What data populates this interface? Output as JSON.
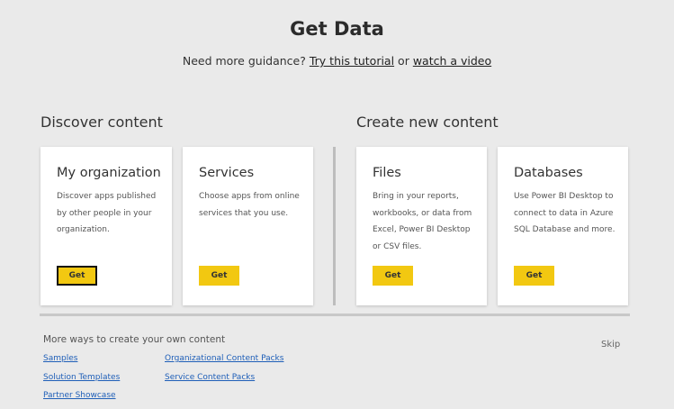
{
  "header": {
    "title": "Get Data",
    "guidance_prefix": "Need more guidance? ",
    "tutorial_link": "Try this tutorial",
    "or_text": " or ",
    "video_link": "watch a video"
  },
  "sections": {
    "discover_heading": "Discover content",
    "create_heading": "Create new content"
  },
  "cards": [
    {
      "title": "My organization",
      "description": "Discover apps published by other people in your organization.",
      "button": "Get"
    },
    {
      "title": "Services",
      "description": "Choose apps from online services that you use.",
      "button": "Get"
    },
    {
      "title": "Files",
      "description": "Bring in your reports, workbooks, or data from Excel, Power BI Desktop or CSV files.",
      "button": "Get"
    },
    {
      "title": "Databases",
      "description": "Use Power BI Desktop to connect to data in Azure SQL Database and more.",
      "button": "Get"
    }
  ],
  "more_ways": {
    "heading": "More ways to create your own content",
    "links": [
      "Samples",
      "Organizational Content Packs",
      "Solution Templates",
      "Service Content Packs",
      "Partner Showcase"
    ]
  },
  "skip_label": "Skip",
  "colors": {
    "accent": "#f2c811",
    "background": "#eaeaea",
    "link": "#1f5fb8"
  }
}
